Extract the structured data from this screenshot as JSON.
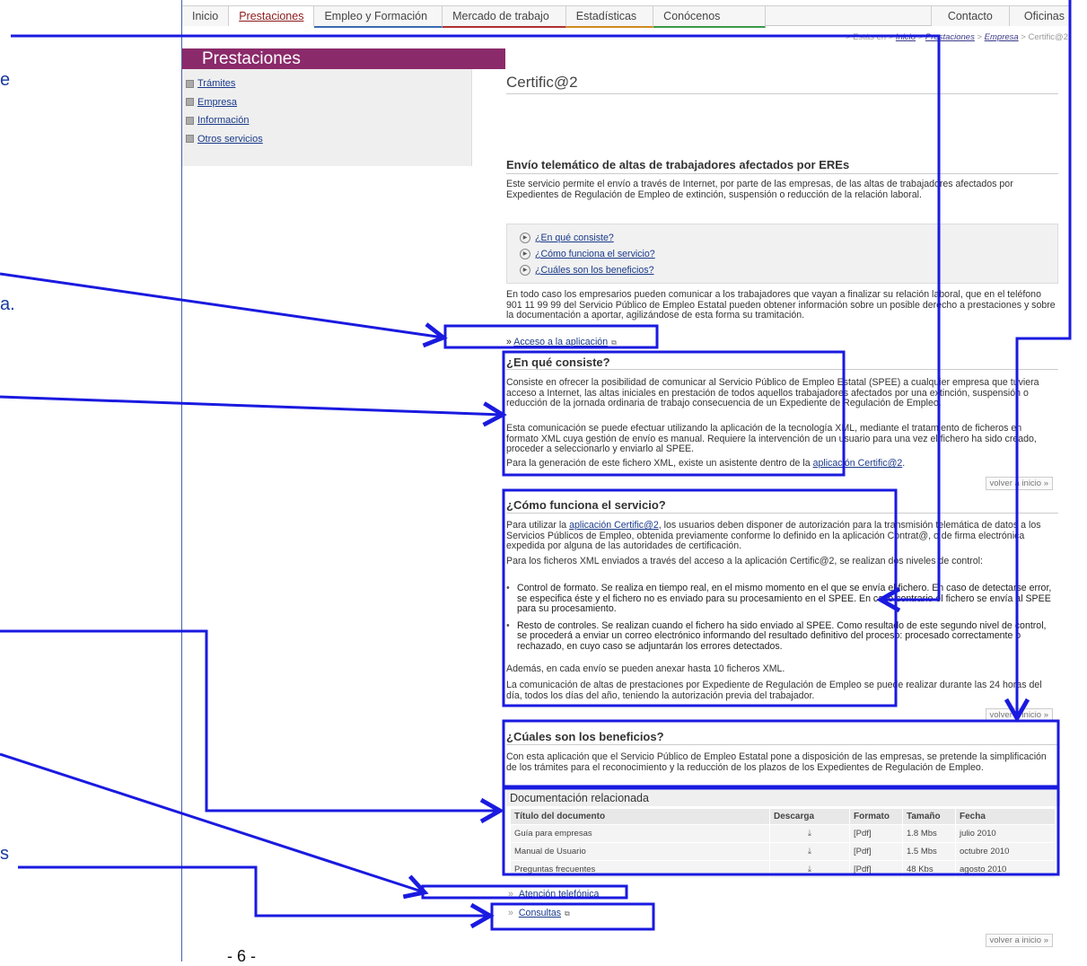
{
  "nav": {
    "tabs": [
      "Inicio",
      "Prestaciones",
      "Empleo y Formación",
      "Mercado de trabajo",
      "Estadísticas",
      "Conócenos"
    ],
    "right_tabs": [
      "Contacto",
      "Oficinas"
    ]
  },
  "breadcrumb": {
    "prefix": "> Estás en >",
    "items": [
      "Inicio",
      "Prestaciones",
      "Empresa"
    ],
    "current": "Certific@2"
  },
  "sidebar": {
    "title": "Prestaciones",
    "items": [
      "Trámites",
      "Empresa",
      "Información",
      "Otros servicios"
    ]
  },
  "main": {
    "title": "Certific@2",
    "section_title": "Envío telemático de altas de trabajadores afectados por EREs",
    "intro": "Este servicio permite el envío a través de Internet, por parte de las empresas, de las altas de trabajadores afectados por Expedientes de Regulación de Empleo de extinción, suspensión o reducción de la relación laboral.",
    "faq_links": [
      "¿En qué consiste?",
      "¿Cómo funciona el servicio?",
      "¿Cuáles son los beneficios?"
    ],
    "note": "En todo caso los empresarios pueden comunicar a los trabajadores que vayan a finalizar su relación laboral, que en el teléfono 901 11 99 99 del Servicio Público de Empleo Estatal pueden obtener información sobre un posible derecho a prestaciones y sobre la documentación a aportar, agilizándose de esta forma su tramitación.",
    "access_link": "Acceso a la aplicación",
    "q1": {
      "title": "¿En qué consiste?",
      "p1": "Consiste en ofrecer la posibilidad de comunicar al Servicio Público de Empleo Estatal (SPEE) a cualquier empresa que tuviera acceso a Internet, las altas iniciales en prestación de todos aquellos trabajadores afectados por una extinción, suspensión o reducción de la jornada ordinaria de trabajo consecuencia de un Expediente de Regulación de Empleo.",
      "p2": "Esta comunicación se puede efectuar utilizando la aplicación de la tecnología XML, mediante el tratamiento de ficheros en formato XML cuya gestión de envío es manual. Requiere la intervención de un usuario para una vez el fichero ha sido creado, proceder a seleccionarlo y enviarlo al SPEE.",
      "p3_a": "Para la generación de este fichero XML, existe un asistente dentro de la ",
      "p3_link": "aplicación Certific@2",
      "p3_b": "."
    },
    "back_to_top": "volver a inicio »",
    "q2": {
      "title": "¿Cómo funciona el servicio?",
      "p1_a": "Para utilizar la ",
      "p1_link": "aplicación Certific@2",
      "p1_b": ", los usuarios deben disponer de autorización para la transmisión telemática de datos a los Servicios Públicos de Empleo, obtenida previamente conforme lo definido en la aplicación Contrat@, o de firma electrónica expedida por alguna de las autoridades de certificación.",
      "p2": "Para los ficheros XML enviados a través del acceso a la aplicación Certific@2, se realizan dos niveles de control:",
      "bullets": [
        "Control de formato. Se realiza en tiempo real, en el mismo momento en el que se envía el fichero. En caso de detectarse error, se especifica éste y el fichero no es enviado para su procesamiento en el SPEE. En caso contrario el fichero se envía al SPEE para su procesamiento.",
        "Resto de controles. Se realizan cuando el fichero ha sido enviado al SPEE. Como resultado de este segundo nivel de control, se procederá a enviar un correo electrónico informando del resultado definitivo del proceso: procesado correctamente o rechazado, en cuyo caso se adjuntarán los errores detectados."
      ],
      "p3": "Además, en cada envío se pueden anexar hasta 10 ficheros XML.",
      "p4": "La comunicación de altas de prestaciones por Expediente de Regulación de Empleo se puede realizar durante las 24 horas del día, todos los días del año, teniendo la autorización previa del trabajador."
    },
    "q3": {
      "title": "¿Cúales son los beneficios?",
      "p1": "Con esta aplicación que el Servicio Público de Empleo Estatal pone a disposición de las empresas, se pretende la simplificación de los trámites para el reconocimiento y la reducción de los plazos de los Expedientes de Regulación de Empleo."
    },
    "docs": {
      "title": "Documentación relacionada",
      "columns": [
        "Título del documento",
        "Descarga",
        "Formato",
        "Tamaño",
        "Fecha"
      ],
      "rows": [
        [
          "Guía para empresas",
          "[Pdf]",
          "1.8 Mbs",
          "julio 2010"
        ],
        [
          "Manual de Usuario",
          "[Pdf]",
          "1.5 Mbs",
          "octubre 2010"
        ],
        [
          "Preguntas frecuentes",
          "[Pdf]",
          "48 Kbs",
          "agosto 2010"
        ]
      ]
    },
    "footer_links": [
      "Atención telefónica",
      "Consultas"
    ]
  },
  "page_number": "- 6 -",
  "margin_fragments": [
    "e",
    "a.",
    "s"
  ],
  "colors": {
    "annotation": "#1a1ae0",
    "sidebar_header": "#8b2a6a"
  }
}
